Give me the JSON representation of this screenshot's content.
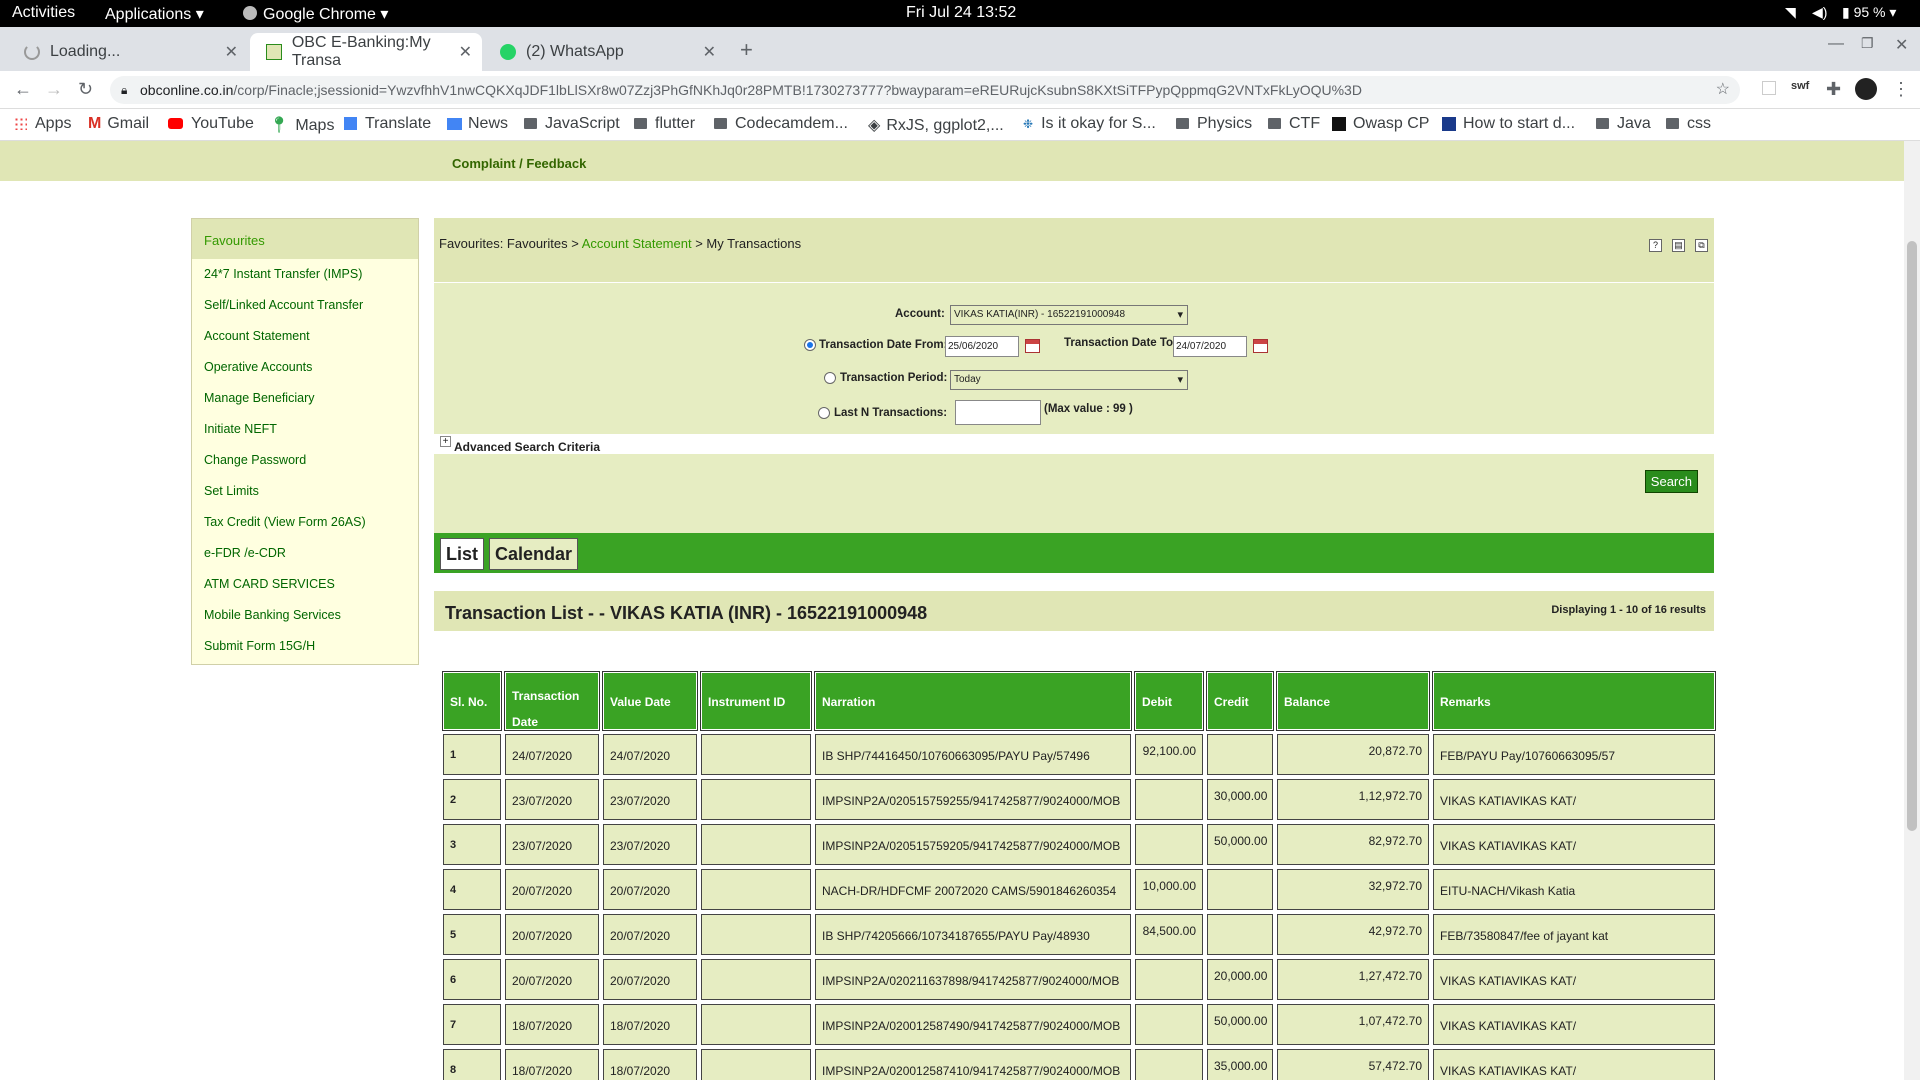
{
  "system": {
    "activities": "Activities",
    "applications": "Applications",
    "browser_app": "Google Chrome",
    "datetime": "Fri Jul 24  13:52",
    "battery": "95 %"
  },
  "tabs": [
    {
      "title": "Loading..."
    },
    {
      "title": "OBC E-Banking:My Transa"
    },
    {
      "title": "(2) WhatsApp"
    }
  ],
  "url": {
    "host": "obconline.co.in",
    "path": "/corp/Finacle;jsessionid=YwzvfhhV1nwCQKXqJDF1lbLlSXr8w07Zzj3PhGfNKhJq0r28PMTB!1730273777?bwayparam=eREURujcKsubnS8KXtSiTFPypQppmqG2VNTxFkLyOQU%3D"
  },
  "toolbar_extra": {
    "swf": "swf"
  },
  "bookmarks": [
    "Apps",
    "Gmail",
    "YouTube",
    "Maps",
    "Translate",
    "News",
    "JavaScript",
    "flutter",
    "Codecamdem...",
    "RxJS, ggplot2,...",
    "Is it okay for S...",
    "Physics",
    "CTF",
    "Owasp CP",
    "How to start d...",
    "Java",
    "css"
  ],
  "page": {
    "complaint": "Complaint / Feedback",
    "sidebar": {
      "header": "Favourites",
      "items": [
        "24*7 Instant Transfer (IMPS)",
        "Self/Linked Account Transfer",
        "Account Statement",
        "Operative Accounts",
        "Manage Beneficiary",
        "Initiate NEFT",
        "Change Password",
        "Set Limits",
        "Tax Credit (View Form 26AS)",
        "e-FDR /e-CDR",
        "ATM CARD SERVICES",
        "Mobile Banking Services",
        "Submit Form 15G/H"
      ]
    },
    "breadcrumb": {
      "part1": "Favourites: Favourites",
      "sep1": ">",
      "link": "Account Statement",
      "sep2": ">",
      "current": "My Transactions"
    },
    "form": {
      "account_label": "Account:",
      "account_value": "VIKAS KATIA(INR) - 16522191000948",
      "date_from_label": "Transaction Date From:",
      "date_from_value": "25/06/2020",
      "date_to_label": "Transaction Date To:",
      "date_to_value": "24/07/2020",
      "period_label": "Transaction Period:",
      "period_value": "Today",
      "lastn_label": "Last N Transactions:",
      "lastn_value": "",
      "lastn_hint": "(Max value : 99 )",
      "advanced": "Advanced Search Criteria",
      "search_button": "Search"
    },
    "view_tabs": [
      "List",
      "Calendar"
    ],
    "list": {
      "title": "Transaction List - - VIKAS KATIA (INR) - 16522191000948",
      "count": "Displaying 1 - 10 of 16 results"
    },
    "table": {
      "headers": [
        "Sl. No.",
        "Transaction Date",
        "Value Date",
        "Instrument ID",
        "Narration",
        "Debit",
        "Credit",
        "Balance",
        "Remarks"
      ],
      "rows": [
        [
          "1",
          "24/07/2020",
          "24/07/2020",
          "",
          "IB SHP/74416450/10760663095/PAYU Pay/57496",
          "92,100.00",
          "",
          "20,872.70",
          "FEB/PAYU Pay/10760663095/57"
        ],
        [
          "2",
          "23/07/2020",
          "23/07/2020",
          "",
          "IMPSINP2A/020515759255/9417425877/9024000/MOB",
          "",
          "30,000.00",
          "1,12,972.70",
          "VIKAS KATIAVIKAS KAT/"
        ],
        [
          "3",
          "23/07/2020",
          "23/07/2020",
          "",
          "IMPSINP2A/020515759205/9417425877/9024000/MOB",
          "",
          "50,000.00",
          "82,972.70",
          "VIKAS KATIAVIKAS KAT/"
        ],
        [
          "4",
          "20/07/2020",
          "20/07/2020",
          "",
          "NACH-DR/HDFCMF 20072020 CAMS/5901846260354",
          "10,000.00",
          "",
          "32,972.70",
          "EITU-NACH/Vikash Katia"
        ],
        [
          "5",
          "20/07/2020",
          "20/07/2020",
          "",
          "IB SHP/74205666/10734187655/PAYU Pay/48930",
          "84,500.00",
          "",
          "42,972.70",
          "FEB/73580847/fee of jayant kat"
        ],
        [
          "6",
          "20/07/2020",
          "20/07/2020",
          "",
          "IMPSINP2A/020211637898/9417425877/9024000/MOB",
          "",
          "20,000.00",
          "1,27,472.70",
          "VIKAS KATIAVIKAS KAT/"
        ],
        [
          "7",
          "18/07/2020",
          "18/07/2020",
          "",
          "IMPSINP2A/020012587490/9417425877/9024000/MOB",
          "",
          "50,000.00",
          "1,07,472.70",
          "VIKAS KATIAVIKAS KAT/"
        ],
        [
          "8",
          "18/07/2020",
          "18/07/2020",
          "",
          "IMPSINP2A/020012587410/9417425877/9024000/MOB",
          "",
          "35,000.00",
          "57,472.70",
          "VIKAS KATIAVIKAS KAT/"
        ]
      ]
    }
  }
}
